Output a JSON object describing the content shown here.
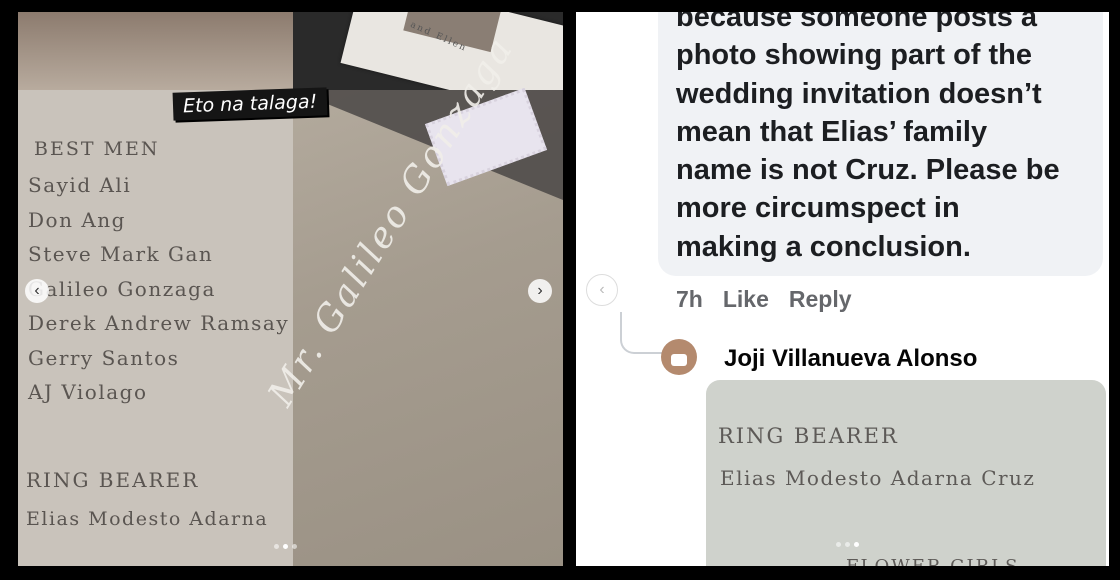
{
  "left_post": {
    "caption": "Eto na talaga!",
    "card_back_text": "and Ellen",
    "best_men_heading": "BEST MEN",
    "best_men": [
      "Sayid Ali",
      "Don Ang",
      "Steve Mark Gan",
      "Galileo Gonzaga",
      "Derek Andrew Ramsay",
      "Gerry Santos",
      "AJ Violago"
    ],
    "ring_bearer_heading": "RING BEARER",
    "ring_bearer_name": "Elias Modesto Adarna",
    "envelope_script": "Mr. Galileo Gonzaga",
    "prev_icon": "‹",
    "next_icon": "›"
  },
  "right_post": {
    "comment_lines": [
      "because someone posts a",
      "photo showing part of the",
      "wedding invitation doesn’t",
      "mean that Elias’ family",
      "name is not Cruz. Please be",
      "more circumspect in",
      "making a conclusion."
    ],
    "time": "7h",
    "like_label": "Like",
    "reply_label": "Reply",
    "reply_author": "Joji Villanueva Alonso",
    "photo_heading": "RING BEARER",
    "photo_name": "Elias Modesto Adarna Cruz",
    "photo_cut_text": "FLOWER GIRLS",
    "prev_icon": "‹"
  },
  "colors": {
    "card": "#c9c3bb",
    "ink": "#5a5551",
    "comment_bg": "#f0f2f5",
    "meta_text": "#65676b"
  }
}
